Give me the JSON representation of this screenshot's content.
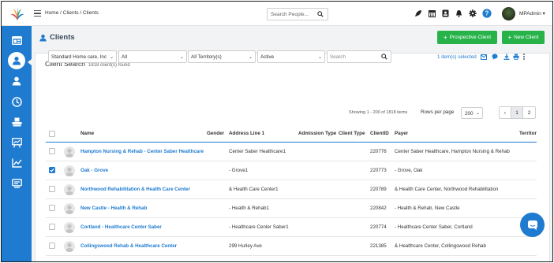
{
  "topbar": {
    "breadcrumb": "Home / Clients / Clients",
    "search_placeholder": "Search People...",
    "icons": [
      "rocket-icon",
      "calendar-icon",
      "report-icon",
      "bell-icon",
      "gear-icon",
      "help-icon"
    ],
    "user_name": "MPAdmin ▾"
  },
  "sidebar": {
    "items": [
      "dashboard-icon",
      "clients-icon",
      "user-icon",
      "clock-icon",
      "billing-icon",
      "reports-icon",
      "chart-icon",
      "forms-icon"
    ],
    "active": "clients-icon"
  },
  "page": {
    "title": "Clients",
    "prospective_button": "Prospective Client",
    "new_button": "New Client"
  },
  "search_panel": {
    "title": "Client Search",
    "count": "1818 client(s) found",
    "filters": {
      "agency": "Standard Home care, Inc",
      "type": "All",
      "territory": "All Territory(s)",
      "status": "Active",
      "search_placeholder": "Search"
    },
    "selected_text": "1 item(s) selected"
  },
  "pagination": {
    "showing": "Showing 1 - 200 of 1818 items",
    "rows_per_page_label": "Rows per page",
    "rows_per_page": "200",
    "prev": "‹",
    "pages": [
      "1",
      "2"
    ],
    "current_page": "1"
  },
  "table": {
    "headers": {
      "name": "Name",
      "gender": "Gender",
      "address": "Address Line 1",
      "admission": "Admission Type",
      "client_type": "Client Type",
      "client_id": "ClientID",
      "payer": "Payer",
      "territory": "Territor"
    },
    "rows": [
      {
        "name": "Hampton Nursing & Rehab - Center Saber Healthcare",
        "address": "Center Saber Healthcare1",
        "client_id": "220776",
        "payer": "Center Saber Healthcare, Hampton Nursing & Rehab",
        "checked": false
      },
      {
        "name": "Oak - Grove",
        "address": "- Grove1",
        "client_id": "220773",
        "payer": "- Grove, Oak",
        "checked": true
      },
      {
        "name": "Northwood Rehabilitation & Health Care Center",
        "address": "& Health Care Center1",
        "client_id": "220789",
        "payer": "& Health Care Center, Northwood Rehabilitation",
        "checked": false
      },
      {
        "name": "New Castle - Health & Rehab",
        "address": "- Health & Rehab1",
        "client_id": "220842",
        "payer": "- Health & Rehab, New Castle",
        "checked": false
      },
      {
        "name": "Cortland - Healthcare Center Saber",
        "address": "- Healthcare Center Saber1",
        "client_id": "220774",
        "payer": "- Healthcare Center Saber, Cortland",
        "checked": false
      },
      {
        "name": "Collingswood Rehab & Healthcare Center",
        "address": "299 Hurley Ave",
        "client_id": "221385",
        "payer": "& Healthcare Center, Collingswood Rehab",
        "checked": false
      }
    ]
  },
  "colors": {
    "primary": "#1e7bd0",
    "green": "#27b34a",
    "background": "#f2f3f5"
  }
}
